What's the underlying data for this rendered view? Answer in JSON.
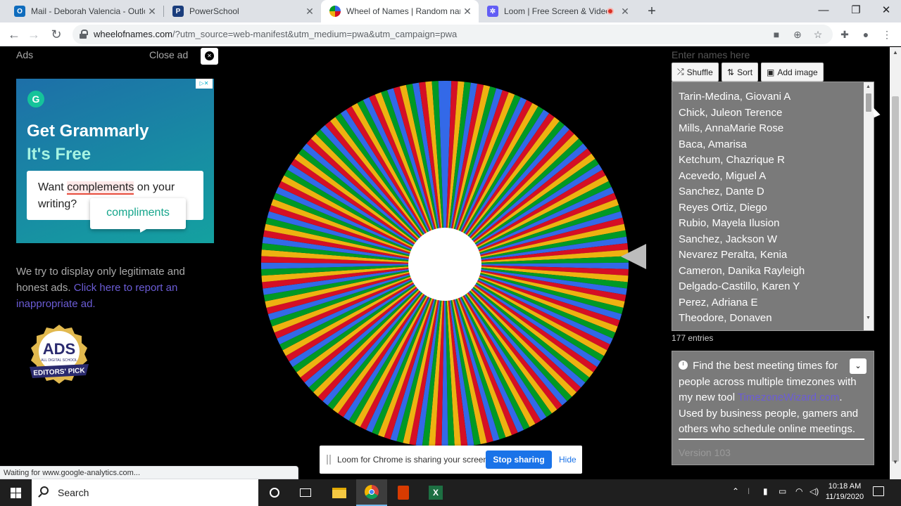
{
  "browser": {
    "tabs": [
      {
        "title": "Mail - Deborah Valencia - Outlook",
        "favicon": "outlook-icon",
        "color": "#0f6cbd",
        "glyph": "O"
      },
      {
        "title": "PowerSchool",
        "favicon": "powerschool-icon",
        "color": "#1a3d7c",
        "glyph": "P"
      },
      {
        "title": "Wheel of Names | Random name picker",
        "favicon": "wheel-icon",
        "color": "#e8a300",
        "glyph": "◎"
      },
      {
        "title": "Loom | Free Screen & Video Recording",
        "favicon": "loom-icon",
        "color": "#625df5",
        "glyph": "✲"
      }
    ],
    "url_host": "wheelofnames.com",
    "url_rest": "/?utm_source=web-manifest&utm_medium=pwa&utm_campaign=pwa",
    "status_text": "Waiting for www.google-analytics.com..."
  },
  "ad_area": {
    "ads_label": "Ads",
    "close_label": "Close ad",
    "headline": "Get Grammarly",
    "subhead": "It's Free",
    "card_pre": "Want ",
    "card_highlight": "complements",
    "card_post": " on your writing?",
    "suggestion": "compliments",
    "adchoice": "▷✕",
    "disclaimer": "We try to display only legitimate and honest ads.",
    "report_link": "Click here to report an inappropriate ad.",
    "badge_top": "ADS",
    "badge_mid": "ALL DIGITAL SCHOOL",
    "badge_bottom": "EDITORS' PICK"
  },
  "wheel": {
    "segment_colors": [
      "#3369e8",
      "#d50f25",
      "#eeb211",
      "#009925"
    ]
  },
  "editor": {
    "placeholder": "Enter names here",
    "shuffle_label": "Shuffle",
    "sort_label": "Sort",
    "add_image_label": "Add image",
    "names": [
      "Tarin-Medina, Giovani A",
      "Chick, Juleon Terence",
      "Mills, AnnaMarie Rose",
      "Baca, Amarisa",
      "Ketchum, Chazrique R",
      "Acevedo, Miguel A",
      "Sanchez, Dante D",
      "Reyes Ortiz, Diego",
      "Rubio, Mayela Ilusion",
      "Sanchez, Jackson W",
      "Nevarez Peralta, Kenia",
      "Cameron, Danika Rayleigh",
      "Delgado-Castillo, Karen Y",
      "Perez, Adriana E",
      "Theodore, Donaven"
    ],
    "entries": "177 entries"
  },
  "info": {
    "line1": "Find the best meeting times for people across multiple timezones with my new tool ",
    "link": "TimezoneWizard.com",
    "line2": ". Used by business people, gamers and others who schedule online meetings.",
    "version": "Version 103"
  },
  "loom": {
    "message": "Loom for Chrome is sharing your screen.",
    "stop_label": "Stop sharing",
    "hide_label": "Hide"
  },
  "taskbar": {
    "search_label": "Search",
    "time": "10:18 AM",
    "date": "11/19/2020"
  }
}
